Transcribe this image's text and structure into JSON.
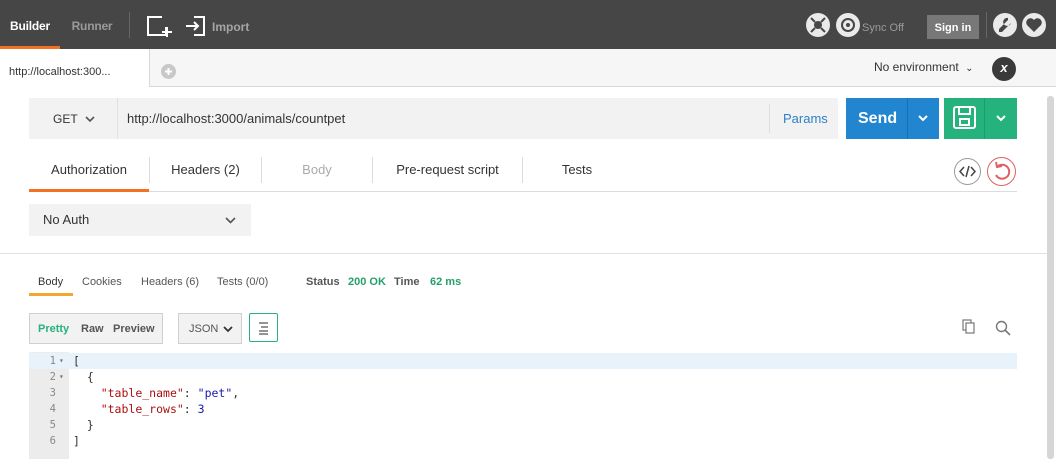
{
  "topbar": {
    "builder_label": "Builder",
    "runner_label": "Runner",
    "import_label": "Import",
    "sync_label": "Sync Off",
    "signin_label": "Sign in"
  },
  "tabs": {
    "active_tab_label": "http://localhost:300..."
  },
  "environment": {
    "selected": "No environment"
  },
  "request": {
    "method": "GET",
    "url": "http://localhost:3000/animals/countpet",
    "params_label": "Params",
    "send_label": "Send"
  },
  "request_tabs": [
    {
      "label": "Authorization"
    },
    {
      "label": "Headers (2)"
    },
    {
      "label": "Body"
    },
    {
      "label": "Pre-request script"
    },
    {
      "label": "Tests"
    }
  ],
  "auth": {
    "type": "No Auth"
  },
  "response": {
    "tabs": [
      {
        "label": "Body"
      },
      {
        "label": "Cookies"
      },
      {
        "label": "Headers (6)"
      },
      {
        "label": "Tests (0/0)"
      }
    ],
    "status_label": "Status",
    "status_value": "200 OK",
    "time_label": "Time",
    "time_value": "62 ms",
    "formats": [
      "Pretty",
      "Raw",
      "Preview"
    ],
    "language": "JSON",
    "lines": [
      {
        "num": "1",
        "text": "["
      },
      {
        "num": "2",
        "text": "  {"
      },
      {
        "num": "3",
        "key": "\"table_name\"",
        "value": "\"pet\""
      },
      {
        "num": "4",
        "key": "\"table_rows\"",
        "value": "3"
      },
      {
        "num": "5",
        "text": "  }"
      },
      {
        "num": "6",
        "text": "]"
      }
    ]
  },
  "colors": {
    "accent": "#f47023",
    "send": "#2185d0",
    "save": "#26b27d",
    "status_ok": "#26b27d"
  }
}
